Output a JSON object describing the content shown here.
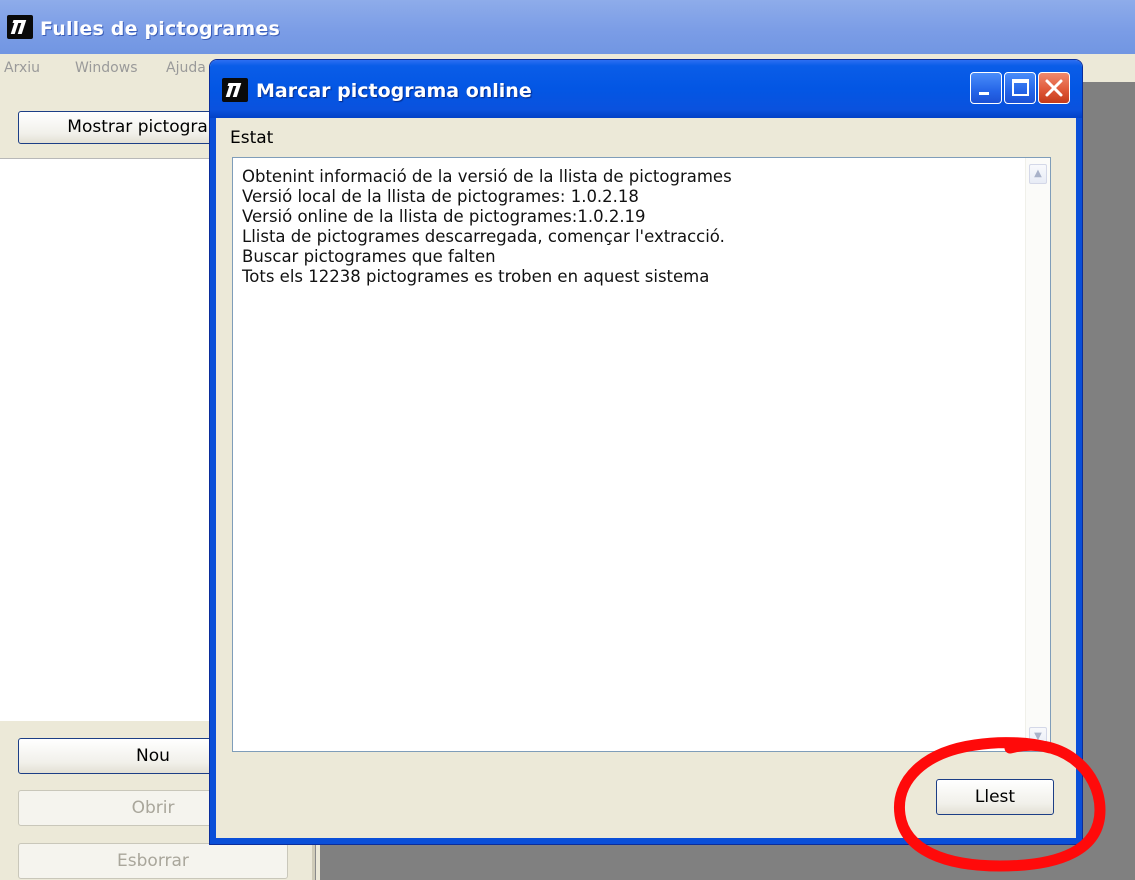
{
  "main_window": {
    "title": "Fulles de pictogrames",
    "menu": [
      "Arxiu",
      "Windows",
      "Ajuda"
    ],
    "show_button": "Mostrar pictogrames",
    "buttons": {
      "new": "Nou",
      "open": "Obrir",
      "delete": "Esborrar"
    }
  },
  "dialog": {
    "title": "Marcar pictograma online",
    "status_label": "Estat",
    "log_lines": [
      "Obtenint informació de la versió de la llista de pictogrames",
      "Versió local de la llista de pictogrames: 1.0.2.18",
      "Versió online de la llista de pictogrames:1.0.2.19",
      "Llista de pictogrames descarregada, començar l'extracció.",
      "Buscar pictogrames que falten",
      "Tots els 12238 pictogrames es troben en aquest sistema"
    ],
    "done_button": "Llest"
  },
  "colors": {
    "xp_blue": "#0356e4",
    "window_face": "#ece9d8",
    "annotation_red": "#ff0a0a"
  },
  "icons": [
    "app-logo-icon",
    "minimize-icon",
    "maximize-icon",
    "close-icon",
    "scroll-up-icon",
    "scroll-down-icon"
  ]
}
